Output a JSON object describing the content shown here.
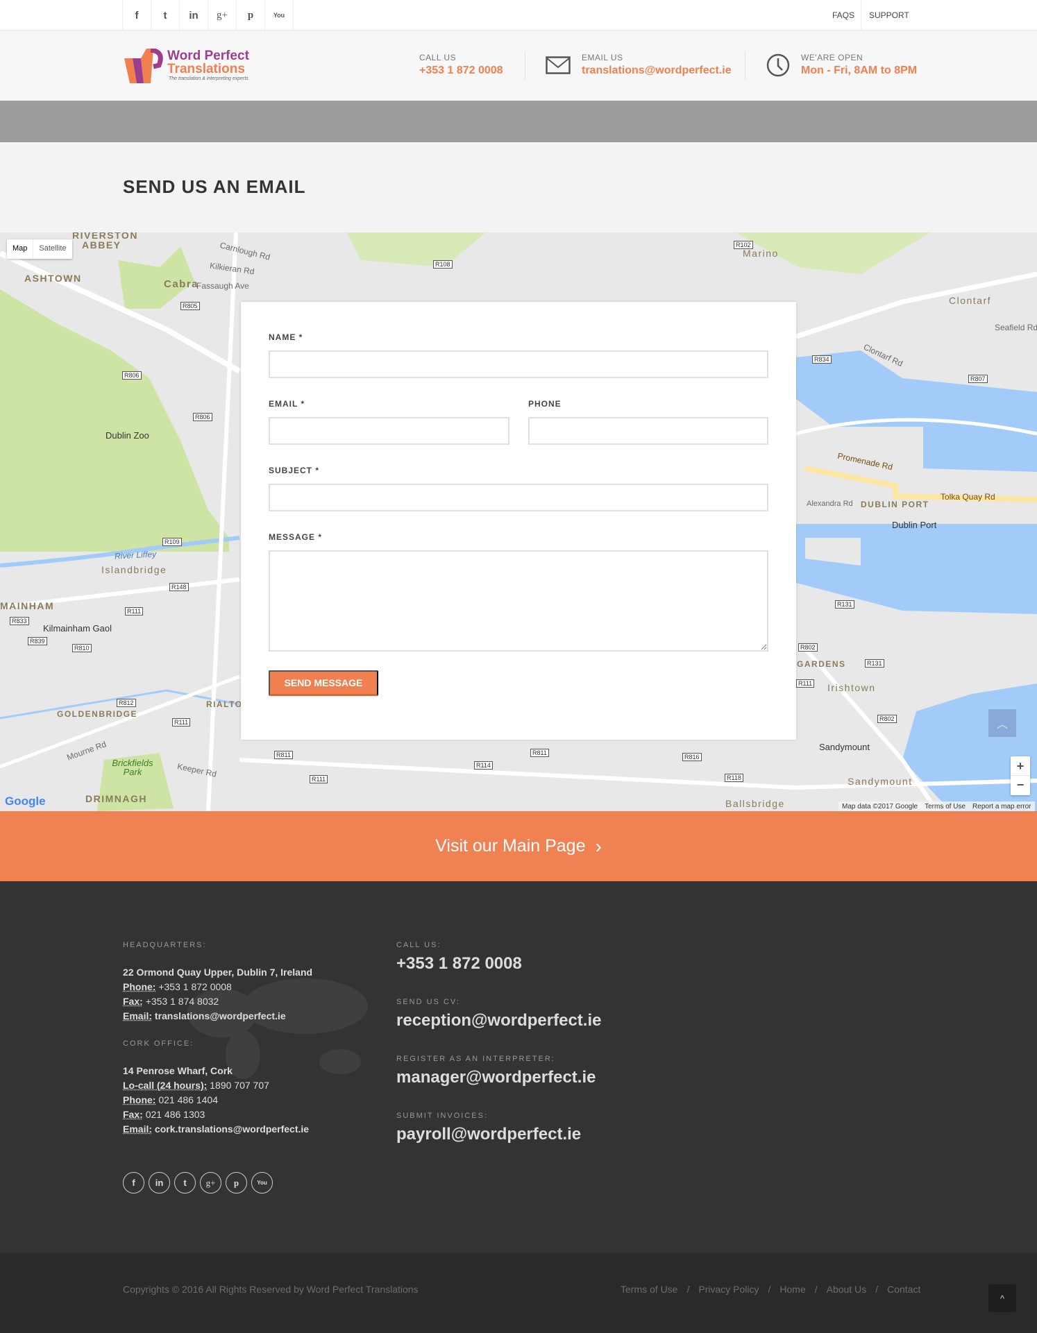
{
  "topbar": {
    "social": [
      {
        "icon": "facebook-icon",
        "glyph": "f"
      },
      {
        "icon": "twitter-icon",
        "glyph": "t"
      },
      {
        "icon": "linkedin-icon",
        "glyph": "in"
      },
      {
        "icon": "google-plus-icon",
        "glyph": "g+"
      },
      {
        "icon": "pinterest-icon",
        "glyph": "p"
      },
      {
        "icon": "youtube-icon",
        "glyph": "You"
      }
    ],
    "faqs": "FAQS",
    "support": "SUPPORT"
  },
  "header": {
    "logo_line1": "Word Perfect",
    "logo_line2": "Translations",
    "logo_tagline": "The translation & interpreting experts",
    "call_label": "CALL US",
    "call_value": "+353 1 872 0008",
    "email_label": "EMAIL US",
    "email_value": "translations@wordperfect.ie",
    "open_label": "WE'ARE OPEN",
    "open_value": "Mon - Fri, 8AM to 8PM"
  },
  "page_title": "SEND US AN EMAIL",
  "map": {
    "type_map": "Map",
    "type_satellite": "Satellite",
    "labels": {
      "riverston": "RIVERSTON",
      "abbey": "ABBEY",
      "ashtown": "ASHTOWN",
      "cabra": "Cabra",
      "fassaugh": "Fassaugh Ave",
      "kilkieran": "Kilkieran Rd",
      "carnlough": "Carnlough Rd",
      "dublin_zoo": "Dublin Zoo",
      "river_liffey": "River Liffey",
      "islandbridge": "Islandbridge",
      "mainham": "MAINHAM",
      "kilmainham_gaol": "Kilmainham Gaol",
      "goldenbridge": "GOLDENBRIDGE",
      "rialto": "RIALTO",
      "brickfields": "Brickfields Park",
      "drimnagh": "DRIMNAGH",
      "mourne": "Mourne Rd",
      "keeper": "Keeper Rd",
      "marino": "Marino",
      "clontarf": "Clontarf",
      "clontarf_rd": "Clontarf Rd",
      "seafield": "Seafield Rd W",
      "promenade": "Promenade Rd",
      "tolka": "Tolka Quay Rd",
      "alexandra": "Alexandra Rd",
      "dublin_port_area": "DUBLIN PORT",
      "dublin_port": "Dublin Port",
      "irishtown": "Irishtown",
      "sandymount_poi": "Sandymount",
      "sandymount": "Sandymount",
      "ballsbridge": "Ballsbridge",
      "gardens": "GARDENS"
    },
    "road_shields": [
      "R805",
      "R806",
      "R806",
      "R109",
      "R148",
      "R111",
      "R833",
      "R839",
      "R810",
      "R812",
      "R111",
      "R811",
      "R111",
      "R114",
      "R811",
      "R816",
      "R118",
      "R807",
      "R834",
      "R131",
      "R802",
      "R111",
      "R131",
      "R802",
      "R108",
      "R102"
    ],
    "google": "Google",
    "attribution": "Map data ©2017 Google",
    "terms": "Terms of Use",
    "report": "Report a map error",
    "zoom_in": "+",
    "zoom_out": "−"
  },
  "form": {
    "name_label": "NAME *",
    "email_label": "EMAIL *",
    "phone_label": "PHONE",
    "subject_label": "SUBJECT *",
    "message_label": "MESSAGE *",
    "name_value": "",
    "email_value": "",
    "phone_value": "",
    "subject_value": "",
    "message_value": "",
    "submit": "SEND MESSAGE"
  },
  "cta": {
    "label": "Visit our Main Page",
    "arrow": "›"
  },
  "footer": {
    "hq_heading": "HEADQUARTERS:",
    "hq_address": "22 Ormond Quay Upper, Dublin 7, Ireland",
    "hq_phone_label": "Phone:",
    "hq_phone": "+353 1 872 0008",
    "hq_fax_label": "Fax:",
    "hq_fax": "+353 1 874 8032",
    "hq_email_label": "Email:",
    "hq_email": "translations@wordperfect.ie",
    "cork_heading": "CORK OFFICE:",
    "cork_address": "14 Penrose Wharf, Cork",
    "cork_locall_label": "Lo-call (24 hours):",
    "cork_locall": "1890 707 707",
    "cork_phone_label": "Phone:",
    "cork_phone": "021 486 1404",
    "cork_fax_label": "Fax:",
    "cork_fax": "021 486 1303",
    "cork_email_label": "Email:",
    "cork_email": "cork.translations@wordperfect.ie",
    "call_heading": "CALL US:",
    "call_value": "+353 1 872 0008",
    "cv_heading": "SEND US CV:",
    "cv_value": "reception@wordperfect.ie",
    "interp_heading": "REGISTER AS AN INTERPRETER:",
    "interp_value": "manager@wordperfect.ie",
    "invoice_heading": "SUBMIT INVOICES:",
    "invoice_value": "payroll@wordperfect.ie",
    "social": [
      {
        "icon": "facebook-icon",
        "glyph": "f"
      },
      {
        "icon": "linkedin-icon",
        "glyph": "in"
      },
      {
        "icon": "twitter-icon",
        "glyph": "t"
      },
      {
        "icon": "google-plus-icon",
        "glyph": "g+"
      },
      {
        "icon": "pinterest-icon",
        "glyph": "p"
      },
      {
        "icon": "youtube-icon",
        "glyph": "You"
      }
    ]
  },
  "bottom": {
    "copyright": "Copyrights © 2016 All Rights Reserved by Word Perfect Translations",
    "links": [
      "Terms of Use",
      "Privacy Policy",
      "Home",
      "About Us",
      "Contact"
    ],
    "sep": "/",
    "back_to_top": "^"
  },
  "colors": {
    "accent": "#f0804f",
    "footer_bg": "#333333",
    "bottom_bg": "#2a2a2a",
    "logo_purple": "#9b3f8c"
  }
}
